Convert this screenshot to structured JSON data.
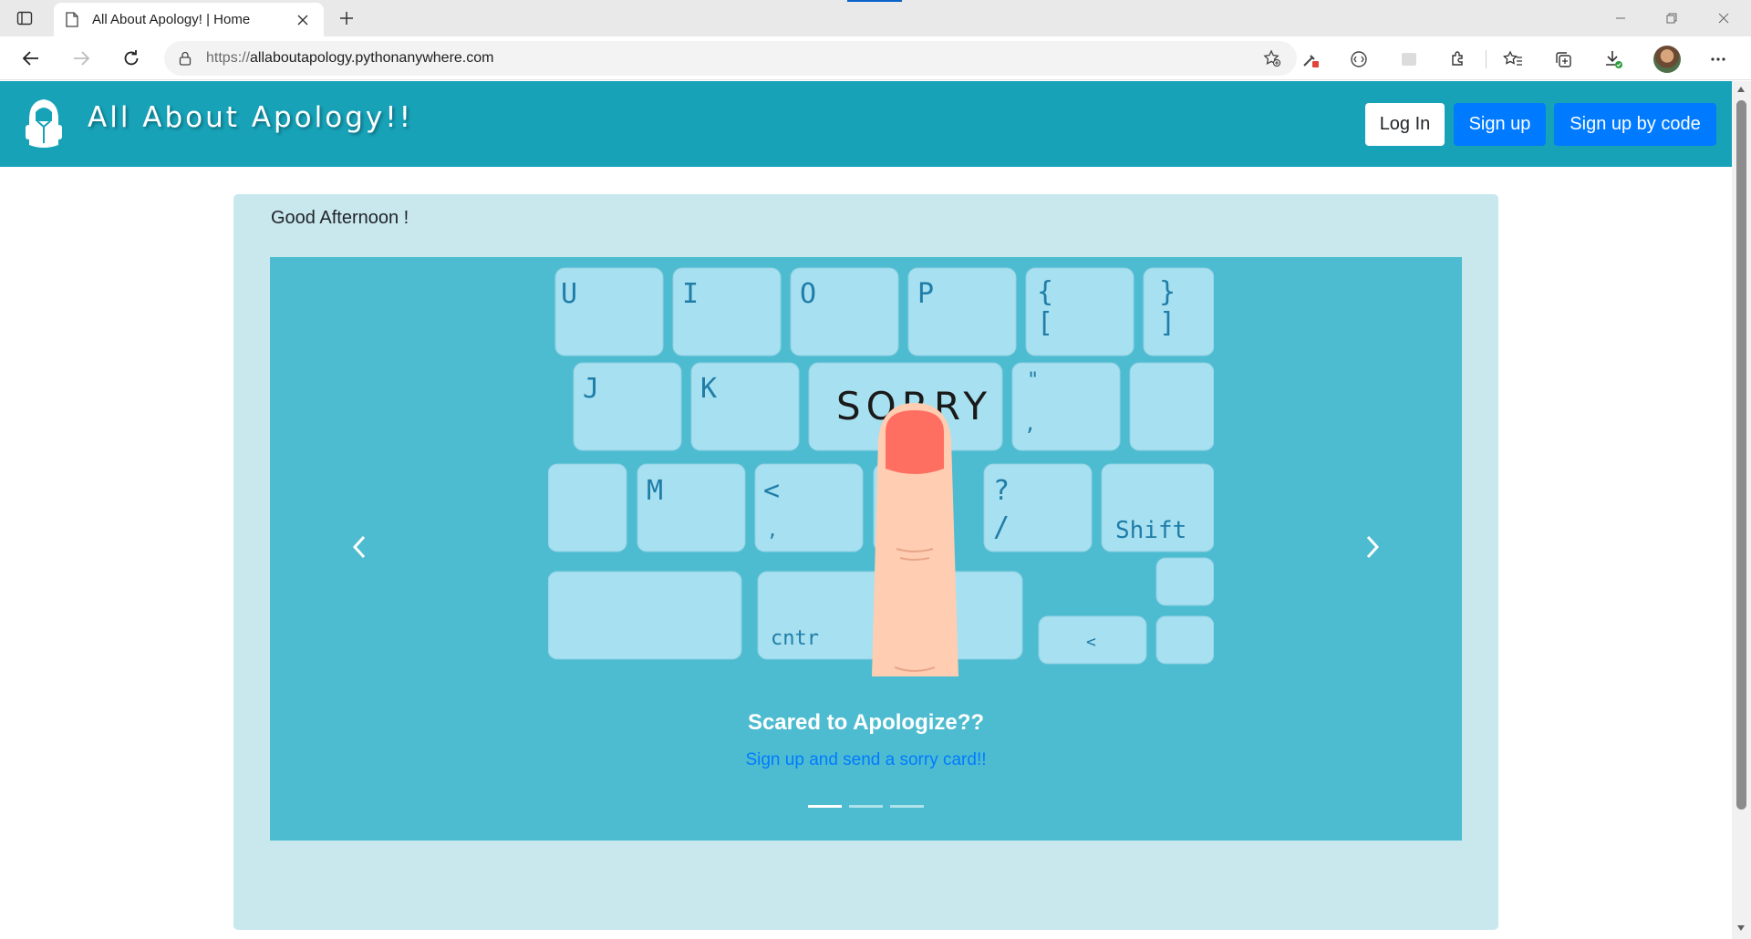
{
  "browser": {
    "tab_title": "All About Apology! | Home",
    "url_protocol": "https://",
    "url_host": "allaboutapology.pythonanywhere.com",
    "icons": [
      "tab-actions-icon",
      "page-icon",
      "close-icon",
      "plus-icon",
      "minimize-icon",
      "restore-icon",
      "close-window-icon",
      "back-icon",
      "forward-icon",
      "refresh-icon",
      "lock-icon",
      "add-favorite-icon",
      "eyedropper-icon",
      "reading-icon",
      "screenshot-icon",
      "extensions-icon",
      "favorites-icon",
      "collections-icon",
      "downloads-icon",
      "more-icon"
    ]
  },
  "site": {
    "brand": "All About Apology!!",
    "nav": {
      "login": "Log In",
      "signup": "Sign up",
      "signup_code": "Sign up by code"
    },
    "colors": {
      "navbar": "#17a2b8",
      "primary": "#007bff",
      "card": "#c8e8ee",
      "carousel": "#4ebcd0"
    }
  },
  "main": {
    "greeting": "Good Afternoon !",
    "carousel": {
      "slide_image": "keyboard with finger pressing SORRY key",
      "keyboard_word": "SORRY",
      "caption_title": "Scared to Apologize??",
      "caption_link": "Sign up and send a sorry card!!",
      "indicator_count": 3,
      "active_indicator": 1
    }
  }
}
